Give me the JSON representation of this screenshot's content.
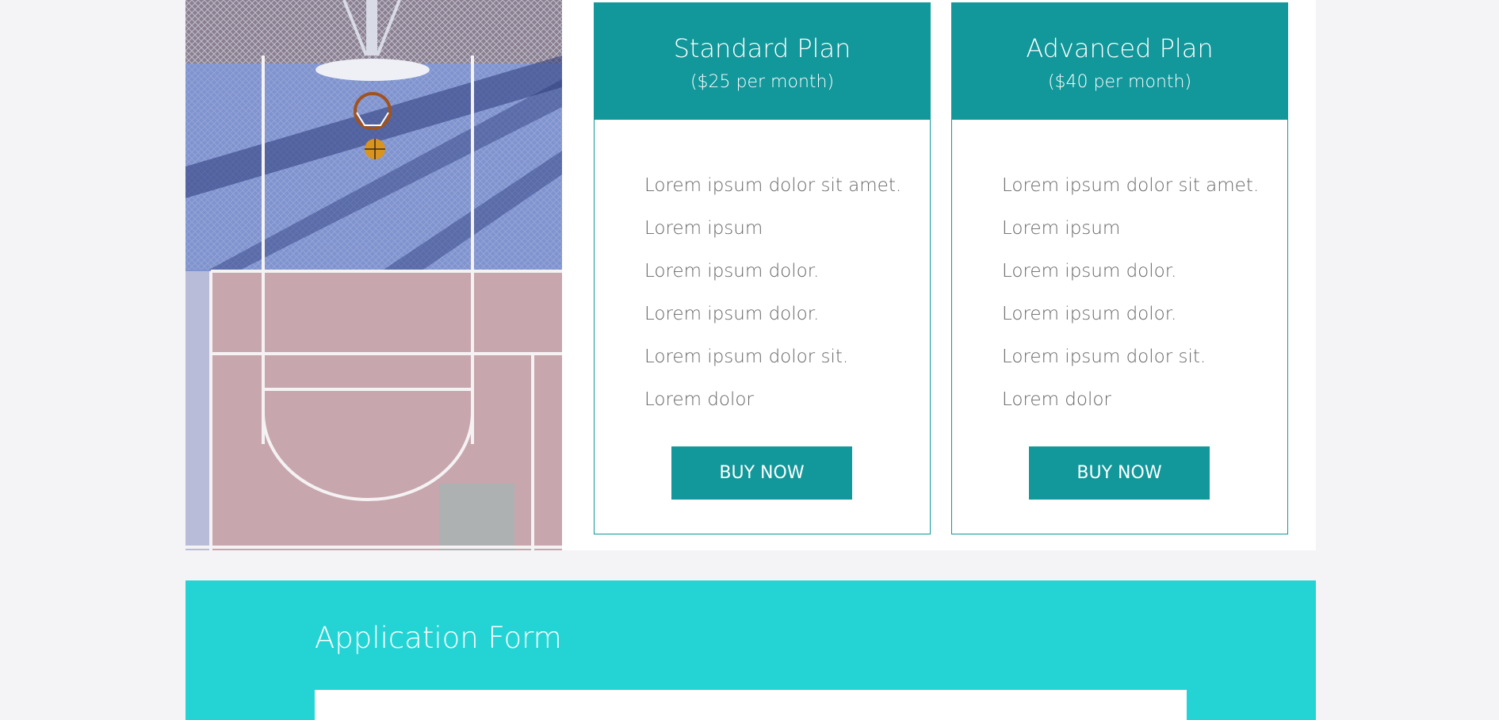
{
  "colors": {
    "accent": "#12979a",
    "app_section_bg": "#24d4d5",
    "page_bg": "#f4f4f6"
  },
  "plans": [
    {
      "name": "Standard Plan",
      "price": "($25 per month)",
      "features": [
        "Lorem ipsum dolor sit amet.",
        "Lorem ipsum",
        "Lorem ipsum dolor.",
        "Lorem ipsum dolor.",
        "Lorem ipsum dolor sit.",
        "Lorem dolor"
      ],
      "button_label": "BUY NOW"
    },
    {
      "name": "Advanced Plan",
      "price": "($40 per month)",
      "features": [
        "Lorem ipsum dolor sit amet.",
        "Lorem ipsum",
        "Lorem ipsum dolor.",
        "Lorem ipsum dolor.",
        "Lorem ipsum dolor sit.",
        "Lorem dolor"
      ],
      "button_label": "BUY NOW"
    }
  ],
  "application": {
    "title": "Application Form"
  }
}
